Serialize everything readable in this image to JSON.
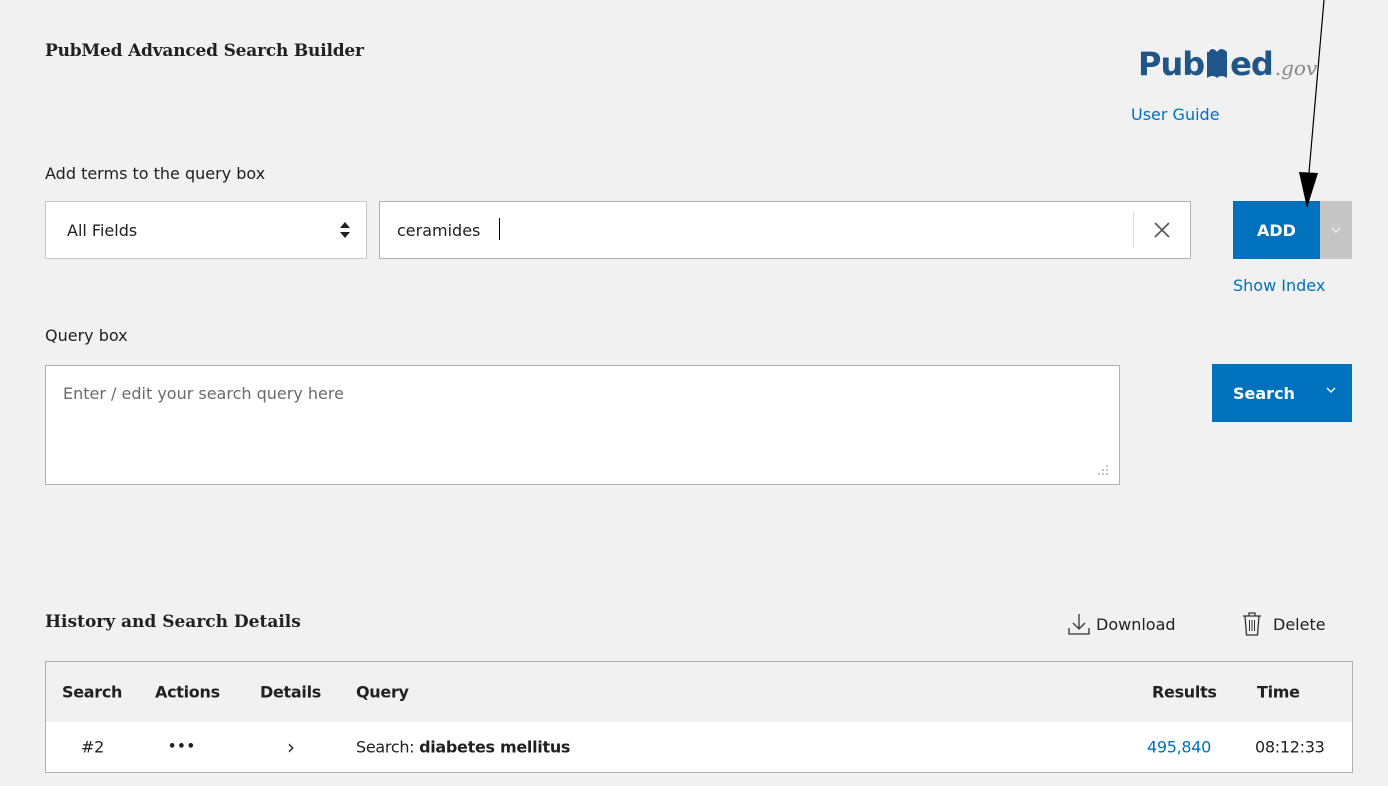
{
  "header": {
    "title": "PubMed Advanced Search Builder",
    "logo": {
      "word_left": "Pub",
      "word_right": "ed",
      "suffix": ".gov",
      "color": "#20558a"
    },
    "user_guide_label": "User Guide"
  },
  "add_terms": {
    "label": "Add terms to the query box",
    "field_select_value": "All Fields",
    "term_value": "ceramides",
    "add_label": "ADD",
    "show_index_label": "Show Index"
  },
  "query_box": {
    "label": "Query box",
    "placeholder": "Enter / edit your search query here",
    "search_label": "Search"
  },
  "history": {
    "title": "History and Search Details",
    "download_label": "Download",
    "delete_label": "Delete",
    "columns": {
      "search": "Search",
      "actions": "Actions",
      "details": "Details",
      "query": "Query",
      "results": "Results",
      "time": "Time"
    },
    "rows": [
      {
        "search": "#2",
        "actions": "•••",
        "details": "›",
        "query_prefix": "Search:",
        "query_term": "diabetes mellitus",
        "results": "495,840",
        "time": "08:12:33"
      }
    ]
  },
  "colors": {
    "primary": "#0071bc",
    "background": "#f1f1f1",
    "disabled": "#c6c6c6"
  }
}
